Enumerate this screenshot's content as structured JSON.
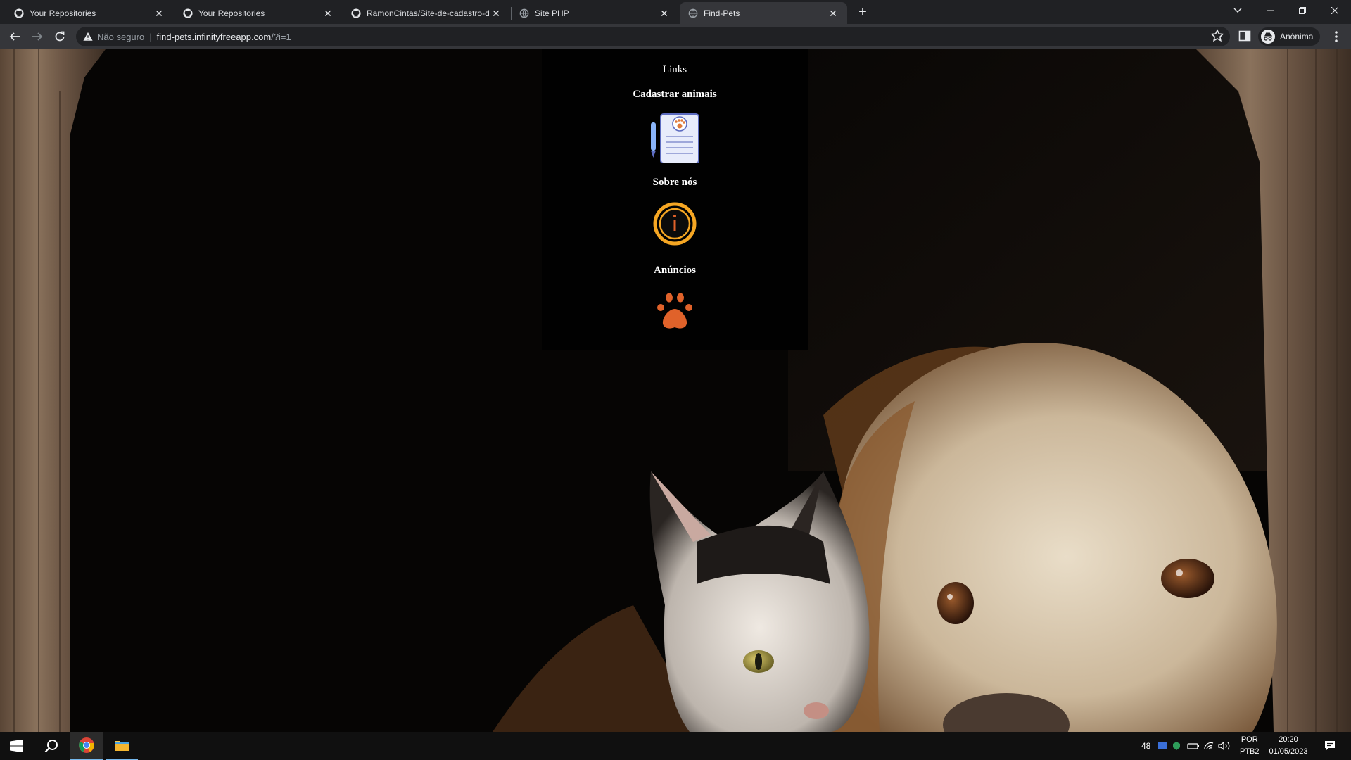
{
  "browser": {
    "tabs": [
      {
        "title": "Your Repositories",
        "icon": "github-icon"
      },
      {
        "title": "Your Repositories",
        "icon": "github-icon"
      },
      {
        "title": "RamonCintas/Site-de-cadastro-d",
        "icon": "github-icon"
      },
      {
        "title": "Site PHP",
        "icon": "globe-icon"
      },
      {
        "title": "Find-Pets",
        "icon": "globe-icon",
        "active": true
      }
    ],
    "address": {
      "security": "Não seguro",
      "host": "find-pets.infinityfreeapp.com",
      "path": "/?i=1"
    },
    "profile": "Anônima"
  },
  "page": {
    "nav_heading": "Links",
    "links": [
      {
        "label": "Cadastrar animais",
        "icon": "register-form-icon"
      },
      {
        "label": "Sobre nós",
        "icon": "info-icon"
      },
      {
        "label": "Anúncios",
        "icon": "paw-icon"
      }
    ],
    "background": "dog-and-cat-photo"
  },
  "taskbar": {
    "tray_count": "48",
    "lang1": "POR",
    "lang2": "PTB2",
    "time": "20:20",
    "date": "01/05/2023"
  },
  "colors": {
    "tab_strip": "#202124",
    "toolbar": "#35363a",
    "paw": "#e0622a",
    "info_ring": "#f5a623"
  }
}
